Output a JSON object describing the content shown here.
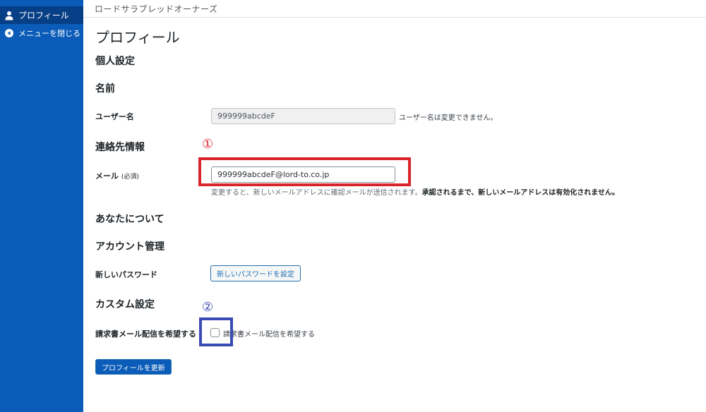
{
  "sidebar": {
    "active_item": {
      "label": "プロフィール",
      "icon": "user-icon"
    },
    "collapse_item": {
      "label": "メニューを閉じる",
      "icon": "collapse-arrow-icon"
    },
    "colors": {
      "background": "#0a5cb8",
      "active": "#073f86"
    }
  },
  "topbar": {
    "site_title": "ロードサラブレッドオーナーズ"
  },
  "main": {
    "page_title": "プロフィール",
    "sections": {
      "personal": "個人設定",
      "name": "名前",
      "contact": "連絡先情報",
      "about": "あなたについて",
      "account": "アカウント管理",
      "custom": "カスタム設定"
    },
    "username": {
      "label": "ユーザー名",
      "value": "999999abcdeF",
      "note": "ユーザー名は変更できません。"
    },
    "email": {
      "label": "メール",
      "required": "(必須)",
      "value": "999999abcdeF@lord-to.co.jp",
      "description_plain": "変更すると、新しいメールアドレスに確認メールが送信されます。",
      "description_bold": "承認されるまで、新しいメールアドレスは有効化されません。"
    },
    "password": {
      "label": "新しいパスワード",
      "button": "新しいパスワードを設定"
    },
    "invoice": {
      "label": "請求書メール配信を希望する",
      "checkbox_label": "請求書メール配信を希望する",
      "checked": false
    },
    "submit_button": "プロフィールを更新",
    "annotations": {
      "first": "①",
      "second": "②",
      "red": "#d8252b",
      "blue": "#3a4bb4"
    }
  }
}
